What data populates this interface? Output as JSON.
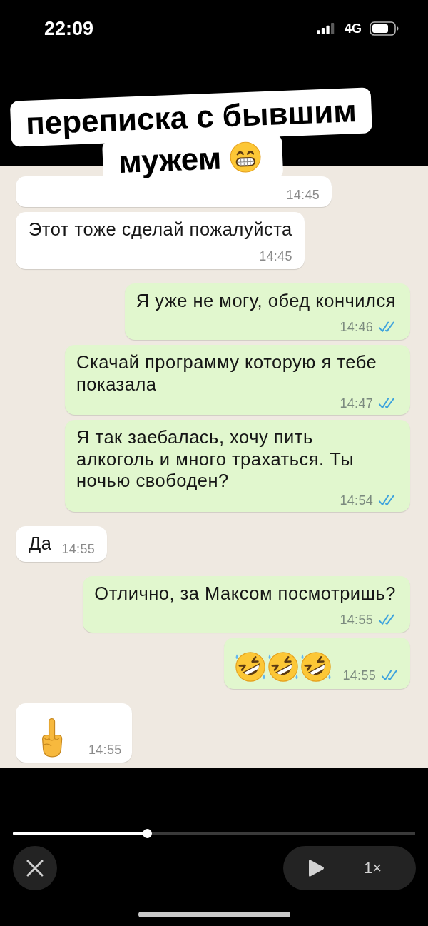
{
  "status_bar": {
    "time": "22:09",
    "network": "4G"
  },
  "caption": {
    "lines": [
      {
        "text": "переписка с бывшим"
      },
      {
        "text": "мужем",
        "emoji": [
          {
            "kind": "grinning"
          }
        ]
      }
    ]
  },
  "messages": [
    {
      "kind": "incoming",
      "time": "14:45"
    },
    {
      "kind": "incoming",
      "text": "Этот тоже сделай пожалуйста",
      "time": "14:45"
    },
    {
      "kind": "outgoing",
      "text": "Я уже не могу, обед кончился",
      "time": "14:46",
      "read": true
    },
    {
      "kind": "outgoing",
      "text": "Скачай программу которую я тебе показала",
      "time": "14:47",
      "read": true
    },
    {
      "kind": "outgoing",
      "text": "Я так заебалась, хочу пить алкоголь и много трахаться. Ты ночью свободен?",
      "time": "14:54",
      "read": true
    },
    {
      "kind": "incoming",
      "text": "Да",
      "time": "14:55"
    },
    {
      "kind": "outgoing",
      "text": "Отлично, за Максом посмотришь?",
      "time": "14:55",
      "read": true
    },
    {
      "kind": "outgoing",
      "emoji": [
        {
          "kind": "laughing"
        },
        {
          "kind": "laughing"
        },
        {
          "kind": "laughing"
        }
      ],
      "time": "14:55",
      "read": true
    },
    {
      "kind": "incoming",
      "emoji": [
        {
          "kind": "middle-finger"
        }
      ],
      "time": "14:55"
    }
  ],
  "player": {
    "progress": {
      "level": 0.335
    },
    "speed": "1×"
  }
}
